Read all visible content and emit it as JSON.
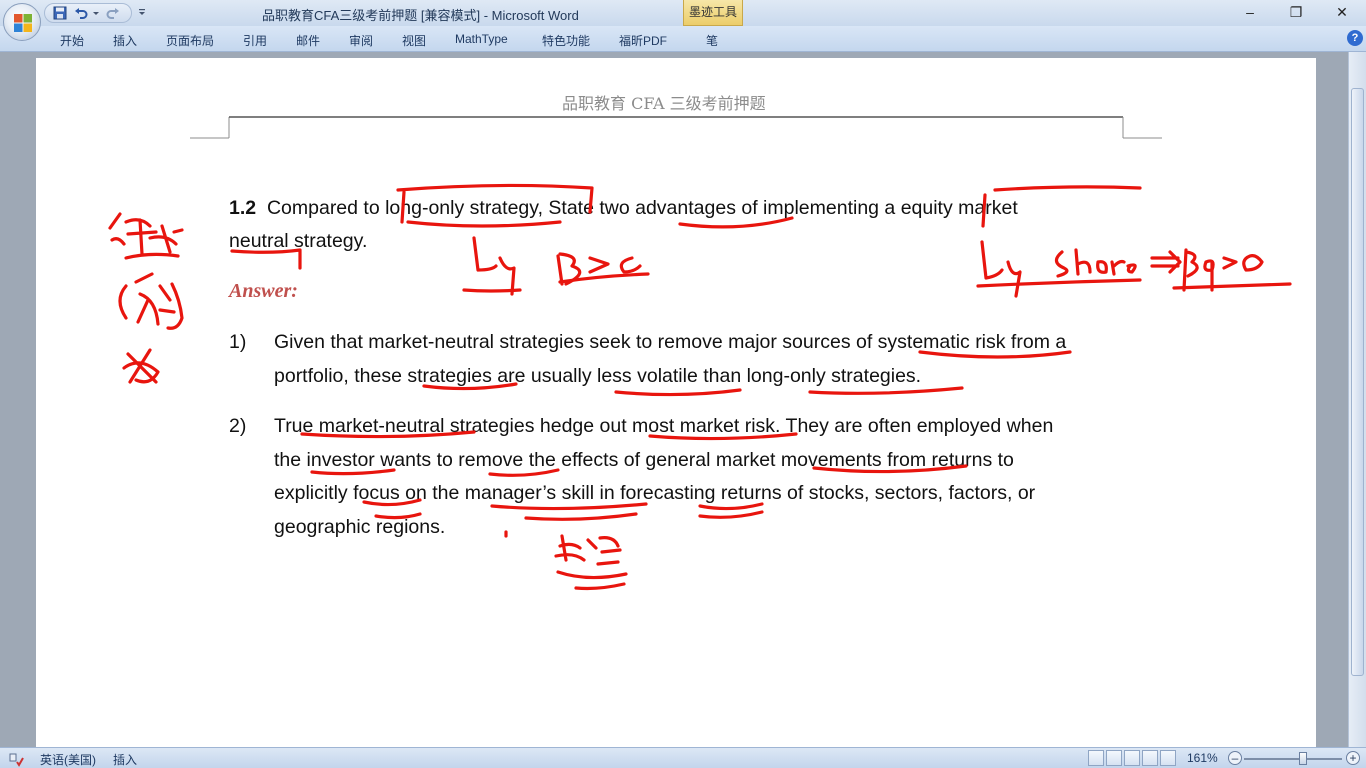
{
  "window": {
    "title": "品职教育CFA三级考前押题 [兼容模式] - Microsoft Word",
    "contextual_tab": "墨迹工具",
    "controls": {
      "minimize": "–",
      "restore": "❐",
      "close": "✕"
    }
  },
  "ribbon": {
    "tabs": [
      "开始",
      "插入",
      "页面布局",
      "引用",
      "邮件",
      "审阅",
      "视图",
      "MathType",
      "特色功能",
      "福昕PDF",
      "笔"
    ],
    "help": "?"
  },
  "document": {
    "header": "品职教育 CFA 三级考前押题",
    "question": {
      "number": "1.2",
      "line1": "Compared to long-only strategy, State two advantages of implementing a equity market",
      "line2": "neutral strategy."
    },
    "answer_label": "Answer:",
    "items": [
      {
        "num": "1)",
        "lines": [
          "Given that market-neutral strategies seek to remove major sources of systematic risk from a",
          "portfolio, these strategies are usually less volatile than long-only strategies."
        ]
      },
      {
        "num": "2)",
        "lines": [
          "True market-neutral strategies hedge out most market risk. They are often employed when",
          "the investor wants to remove the effects of general market movements from returns to",
          "explicitly focus on the manager’s skill in forecasting returns of stocks, sectors, factors, or",
          "geographic regions."
        ]
      }
    ],
    "ink_color": "#e8150e"
  },
  "statusbar": {
    "language": "英语(美国)",
    "mode": "插入",
    "zoom": "161%",
    "zoom_level": 0.6
  }
}
